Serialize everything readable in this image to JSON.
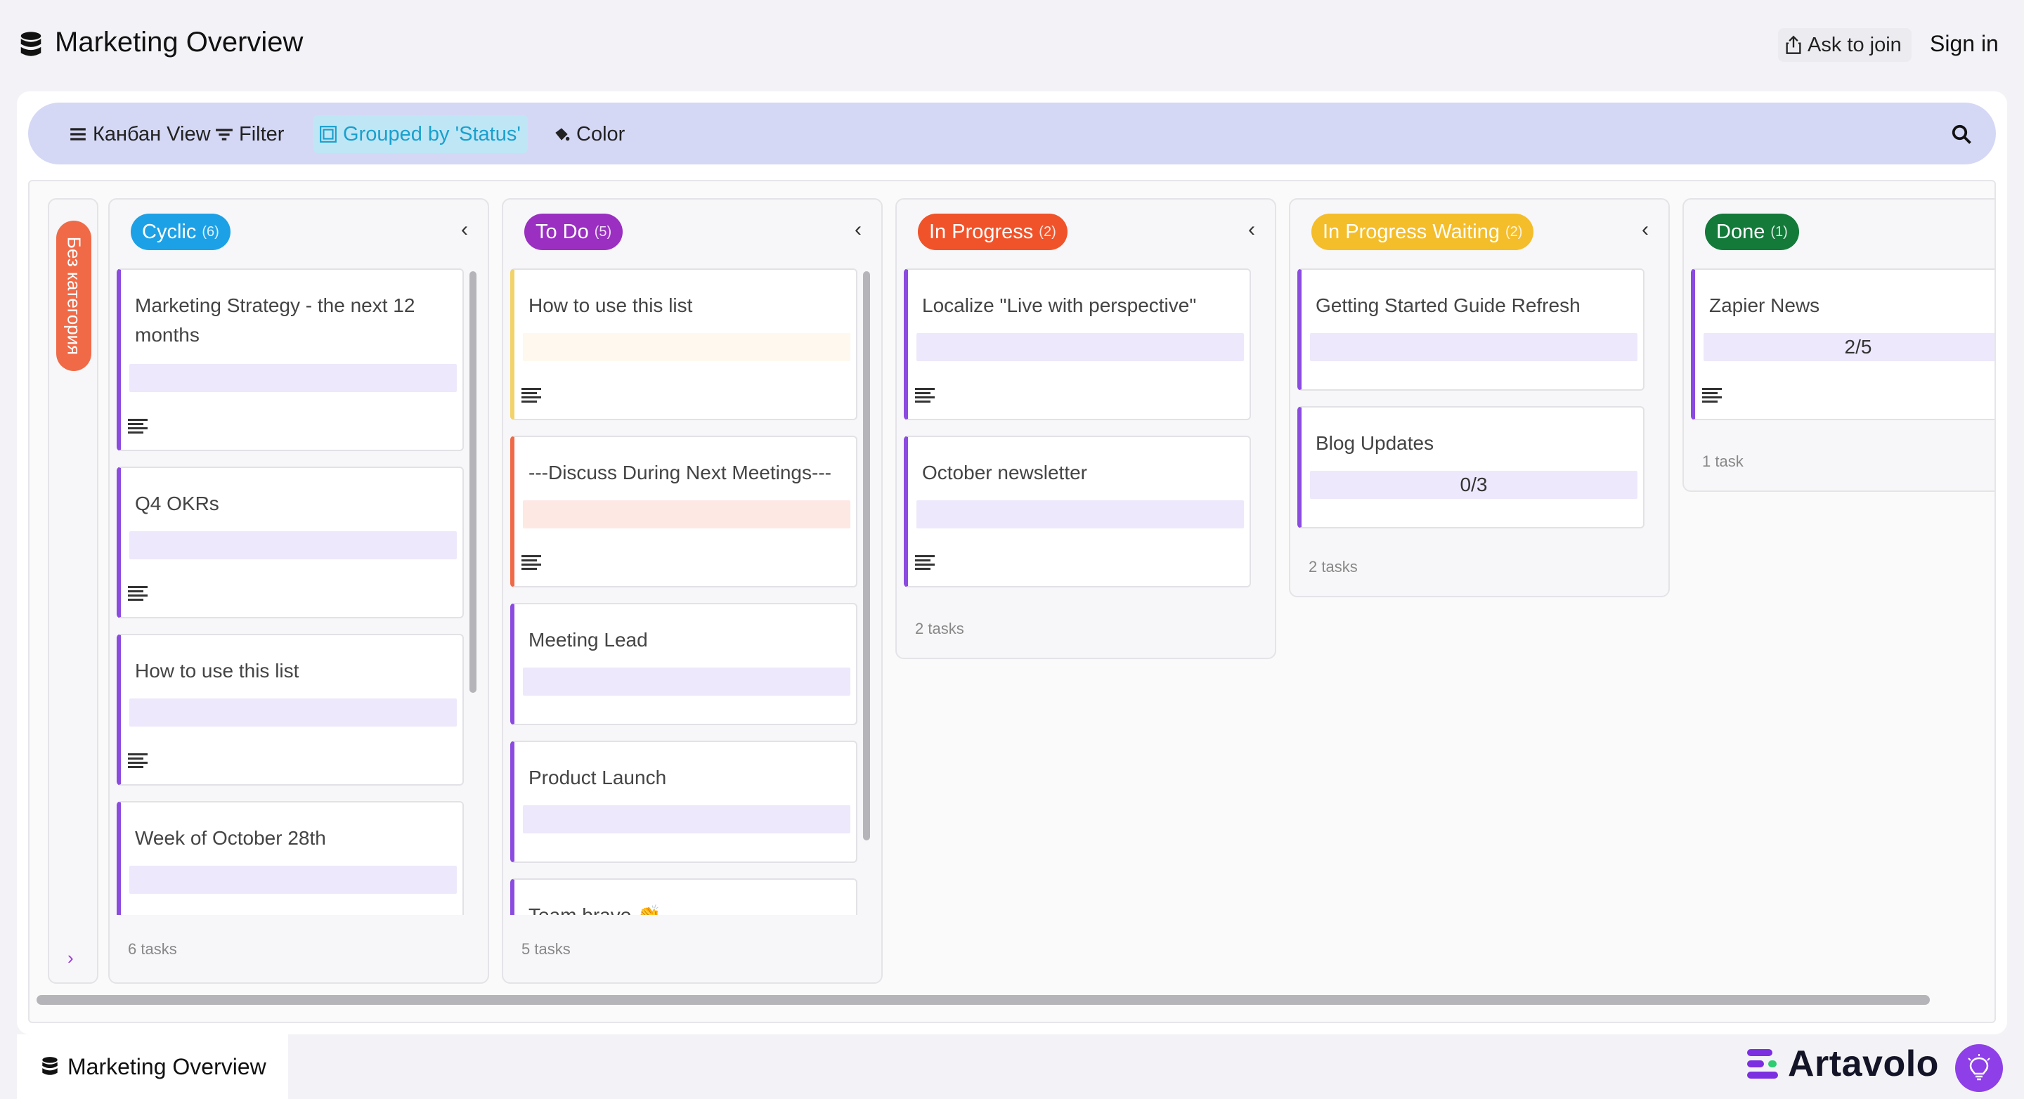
{
  "header": {
    "title": "Marketing Overview",
    "ask_label": "Ask to join",
    "signin_label": "Sign in"
  },
  "toolbar": {
    "view_label": "Канбан View",
    "filter_label": "Filter",
    "group_label": "Grouped by 'Status'",
    "color_label": "Color"
  },
  "sidebar_group": {
    "label": "Без категория",
    "color": "#f06a47"
  },
  "columns": [
    {
      "name": "Cyclic",
      "count": "(6)",
      "color": "#1da1e6",
      "footer": "6 tasks",
      "cards": [
        {
          "title": "Marketing Strategy - the next 12 months",
          "progress": "",
          "has_notes": true
        },
        {
          "title": "Q4 OKRs",
          "progress": "",
          "has_notes": true
        },
        {
          "title": "How to use this list",
          "progress": "",
          "has_notes": true
        },
        {
          "title": "Week of October 28th",
          "progress": "",
          "has_notes": false
        }
      ]
    },
    {
      "name": "To Do",
      "count": "(5)",
      "color": "#9a2fc1",
      "footer": "5 tasks",
      "cards": [
        {
          "title": "How to use this list",
          "progress": "",
          "has_notes": true,
          "accent": "#f2d36a",
          "bar_color": "#fff8ee"
        },
        {
          "title": "---Discuss During Next Meetings---",
          "progress": "",
          "has_notes": true,
          "accent": "#f06a47",
          "bar_color": "#fde8e4"
        },
        {
          "title": "Meeting Lead",
          "progress": "",
          "has_notes": false
        },
        {
          "title": "Product Launch",
          "progress": "",
          "has_notes": false
        },
        {
          "title": "Team bravo 👏",
          "progress": "",
          "has_notes": false
        }
      ]
    },
    {
      "name": "In Progress",
      "count": "(2)",
      "color": "#f0532a",
      "footer": "2 tasks",
      "cards": [
        {
          "title": "Localize \"Live with perspective\"",
          "progress": "",
          "has_notes": true
        },
        {
          "title": "October newsletter",
          "progress": "",
          "has_notes": true
        }
      ]
    },
    {
      "name": "In Progress Waiting",
      "count": "(2)",
      "color": "#f4bd2a",
      "footer": "2 tasks",
      "cards": [
        {
          "title": "Getting Started Guide Refresh",
          "progress": "",
          "has_notes": false
        },
        {
          "title": "Blog Updates",
          "progress": "0/3",
          "has_notes": false
        }
      ]
    },
    {
      "name": "Done",
      "count": "(1)",
      "color": "#137a3a",
      "footer": "1 task",
      "cards": [
        {
          "title": "Zapier News",
          "progress": "2/5",
          "has_notes": true
        }
      ]
    }
  ],
  "footer": {
    "tab_label": "Marketing Overview",
    "brand": "Artavolo"
  }
}
